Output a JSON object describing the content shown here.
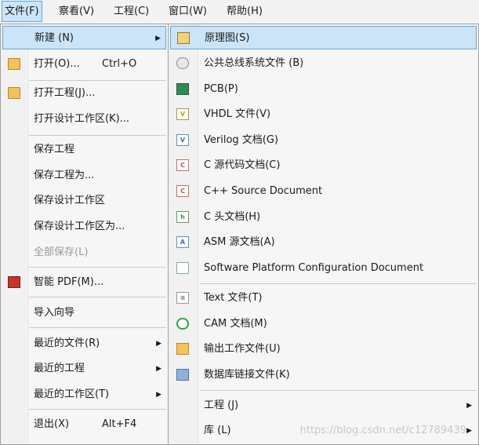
{
  "menubar": {
    "items": [
      {
        "label": "文件(F)"
      },
      {
        "label": "察看(V)"
      },
      {
        "label": "工程(C)"
      },
      {
        "label": "窗口(W)"
      },
      {
        "label": "帮助(H)"
      }
    ]
  },
  "file_menu": {
    "items": [
      {
        "label": "新建 (N)",
        "shortcut": "",
        "arrow": "▶",
        "icon": "none"
      },
      {
        "label": "打开(O)...",
        "shortcut": "Ctrl+O",
        "arrow": "",
        "icon": "open-folder-icon"
      },
      {
        "label": "打开工程(J)...",
        "shortcut": "",
        "arrow": "",
        "icon": "open-project-icon"
      },
      {
        "label": "打开设计工作区(K)...",
        "shortcut": "",
        "arrow": "",
        "icon": "none"
      },
      {
        "label": "保存工程",
        "shortcut": "",
        "arrow": "",
        "icon": "none"
      },
      {
        "label": "保存工程为...",
        "shortcut": "",
        "arrow": "",
        "icon": "none"
      },
      {
        "label": "保存设计工作区",
        "shortcut": "",
        "arrow": "",
        "icon": "none"
      },
      {
        "label": "保存设计工作区为...",
        "shortcut": "",
        "arrow": "",
        "icon": "none"
      },
      {
        "label": "全部保存(L)",
        "shortcut": "",
        "arrow": "",
        "icon": "none",
        "disabled": true
      },
      {
        "label": "智能 PDF(M)...",
        "shortcut": "",
        "arrow": "",
        "icon": "smart-pdf-icon"
      },
      {
        "label": "导入向导",
        "shortcut": "",
        "arrow": "",
        "icon": "none"
      },
      {
        "label": "最近的文件(R)",
        "shortcut": "",
        "arrow": "▶",
        "icon": "none"
      },
      {
        "label": "最近的工程",
        "shortcut": "",
        "arrow": "▶",
        "icon": "none"
      },
      {
        "label": "最近的工作区(T)",
        "shortcut": "",
        "arrow": "▶",
        "icon": "none"
      },
      {
        "label": "退出(X)",
        "shortcut": "Alt+F4",
        "arrow": "",
        "icon": "none"
      }
    ]
  },
  "new_submenu": {
    "items": [
      {
        "label": "原理图(S)",
        "arrow": "",
        "icon": "schematic-icon"
      },
      {
        "label": "公共总线系统文件 (B)",
        "arrow": "",
        "icon": "bus-system-icon"
      },
      {
        "label": "PCB(P)",
        "arrow": "",
        "icon": "pcb-icon"
      },
      {
        "label": "VHDL 文件(V)",
        "arrow": "",
        "icon": "vhdl-file-icon"
      },
      {
        "label": "Verilog 文档(G)",
        "arrow": "",
        "icon": "verilog-file-icon"
      },
      {
        "label": "C 源代码文档(C)",
        "arrow": "",
        "icon": "c-source-icon"
      },
      {
        "label": "C++ Source Document",
        "arrow": "",
        "icon": "cpp-source-icon"
      },
      {
        "label": "C 头文档(H)",
        "arrow": "",
        "icon": "c-header-icon"
      },
      {
        "label": "ASM 源文档(A)",
        "arrow": "",
        "icon": "asm-source-icon"
      },
      {
        "label": "Software Platform Configuration Document",
        "arrow": "",
        "icon": "software-platform-icon"
      },
      {
        "label": "Text  文件(T)",
        "arrow": "",
        "icon": "text-file-icon"
      },
      {
        "label": "CAM 文档(M)",
        "arrow": "",
        "icon": "cam-document-icon"
      },
      {
        "label": "输出工作文件(U)",
        "arrow": "",
        "icon": "output-job-icon"
      },
      {
        "label": "数据库链接文件(K)",
        "arrow": "",
        "icon": "database-link-icon"
      },
      {
        "label": "工程 (J)",
        "arrow": "▶",
        "icon": "none"
      },
      {
        "label": "库 (L)",
        "arrow": "▶",
        "icon": "none"
      }
    ]
  },
  "watermark": {
    "text": "https://blog.csdn.net/c12789439"
  }
}
